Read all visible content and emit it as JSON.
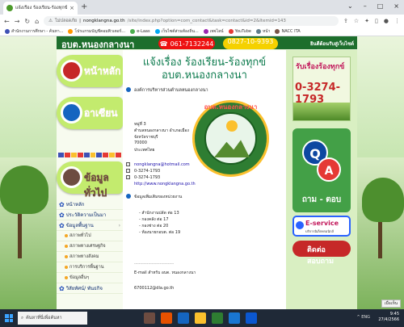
{
  "browser": {
    "tab_title": "แจ้งเรื่อง ร้องเรียน-ร้องทุกข์ อบต.หนองกลางนา",
    "new_tab": "+",
    "tab_close": "×",
    "min": "⌄",
    "restore": "–",
    "max": "□",
    "close": "×",
    "url_secure_label": "ไม่ปลอดภัย",
    "url_domain": "nongklangna.go.th",
    "url_path": "/site/index.php?option=com_contact&task=contact&id=2&Itemid=143",
    "bookmarks": [
      {
        "label": "สำนักงานการศึกษา - ค้นหา...",
        "color": "#3f51b5"
      },
      {
        "label": "โปรแกรมบัญชีคอมพิวเตอร์...",
        "color": "#ff9800"
      },
      {
        "label": "e-Laas",
        "color": "#4caf50"
      },
      {
        "label": "เว็บไซต์ส่วนท้องถิ่น...",
        "color": "#03a9f4"
      },
      {
        "label": "เพจไลน์",
        "color": "#9c27b0"
      },
      {
        "label": "YouTube",
        "color": "#e53935"
      },
      {
        "label": "หน้า",
        "color": "#607d8b"
      },
      {
        "label": "NACC ITA",
        "color": "#795548"
      }
    ]
  },
  "site": {
    "banner_left": "อบต.หนองกลางนา",
    "banner_phone": "061-7132244",
    "banner_phone2": "0827-10-9393",
    "banner_right": "ยินดีต้อนรับสู่เว็บไซต์",
    "left_menu": {
      "home_btn": "หน้าหลัก",
      "asean_btn": "อาเซียน",
      "info_btn": "ข้อมูลทั่วไป",
      "items": [
        {
          "label": "หน้าหลัก",
          "sub": false
        },
        {
          "label": "ประวัติความเป็นมา",
          "sub": false
        },
        {
          "label": "ข้อมูลพื้นฐาน",
          "sub": false
        },
        {
          "label": "สภาพทั่วไป",
          "sub": true
        },
        {
          "label": "สภาพทางเศรษฐกิจ",
          "sub": true
        },
        {
          "label": "สภาพทางสังคม",
          "sub": true
        },
        {
          "label": "การบริการพื้นฐาน",
          "sub": true
        },
        {
          "label": "ข้อมูลอื่นๆ",
          "sub": true
        },
        {
          "label": "วิสัยทัศน์/ พันธกิจ",
          "sub": false
        }
      ]
    },
    "content": {
      "title": "แจ้งเรื่อง ร้องเรียน-ร้องทุกข์ อบต.หนองกลางนา",
      "seal_text": "อบต.หนองกลางนา",
      "org_name": "องค์การบริหารส่วนตำบลหนองกลางนา",
      "address": [
        "หมู่ที่ 3",
        "ตำบลหนองกลางนา อำเภอเมือง",
        "จังหวัดราชบุรี",
        "70000",
        "ประเทศไทย"
      ],
      "email": "nongklangna@hotmail.com",
      "phone": "0-3274-1793",
      "fax": "0-3274-1793",
      "website": "http://www.nongklangna.go.th",
      "misc_title": "ข้อมูลเพิ่มเติมของหน่วยงาน",
      "staff": [
        "- สำนักงานปลัด ต่อ 13",
        "- กองคลัง ต่อ 17",
        "- กองช่าง ต่อ 20",
        "- ห้องนายกอบต. ต่อ 19"
      ],
      "dashes": "----------------------------------",
      "email_label": "E-mail สำหรับ อบต. หนองกลางนา",
      "email_code": "6700112@dla.go.th"
    },
    "right": {
      "complaint_title": "รับเรื่องร้องทุกข์",
      "complaint_phone": "0-3274-1793",
      "qa_q": "Q",
      "qa_a": "A",
      "qa_label": "ถาม - ตอบ",
      "eservice_title": "E-service",
      "eservice_sub": "บริการอิเล็กทรอนิกส์",
      "red_btn": "ติดต่อสอบถาม"
    },
    "chat_btn": "เมื่อเห็น"
  },
  "taskbar": {
    "search_placeholder": "ค้นหาที่นี่เพื่อค้นหา",
    "tray": "^ ENG",
    "time": "9:45",
    "date": "27/4/2566"
  }
}
